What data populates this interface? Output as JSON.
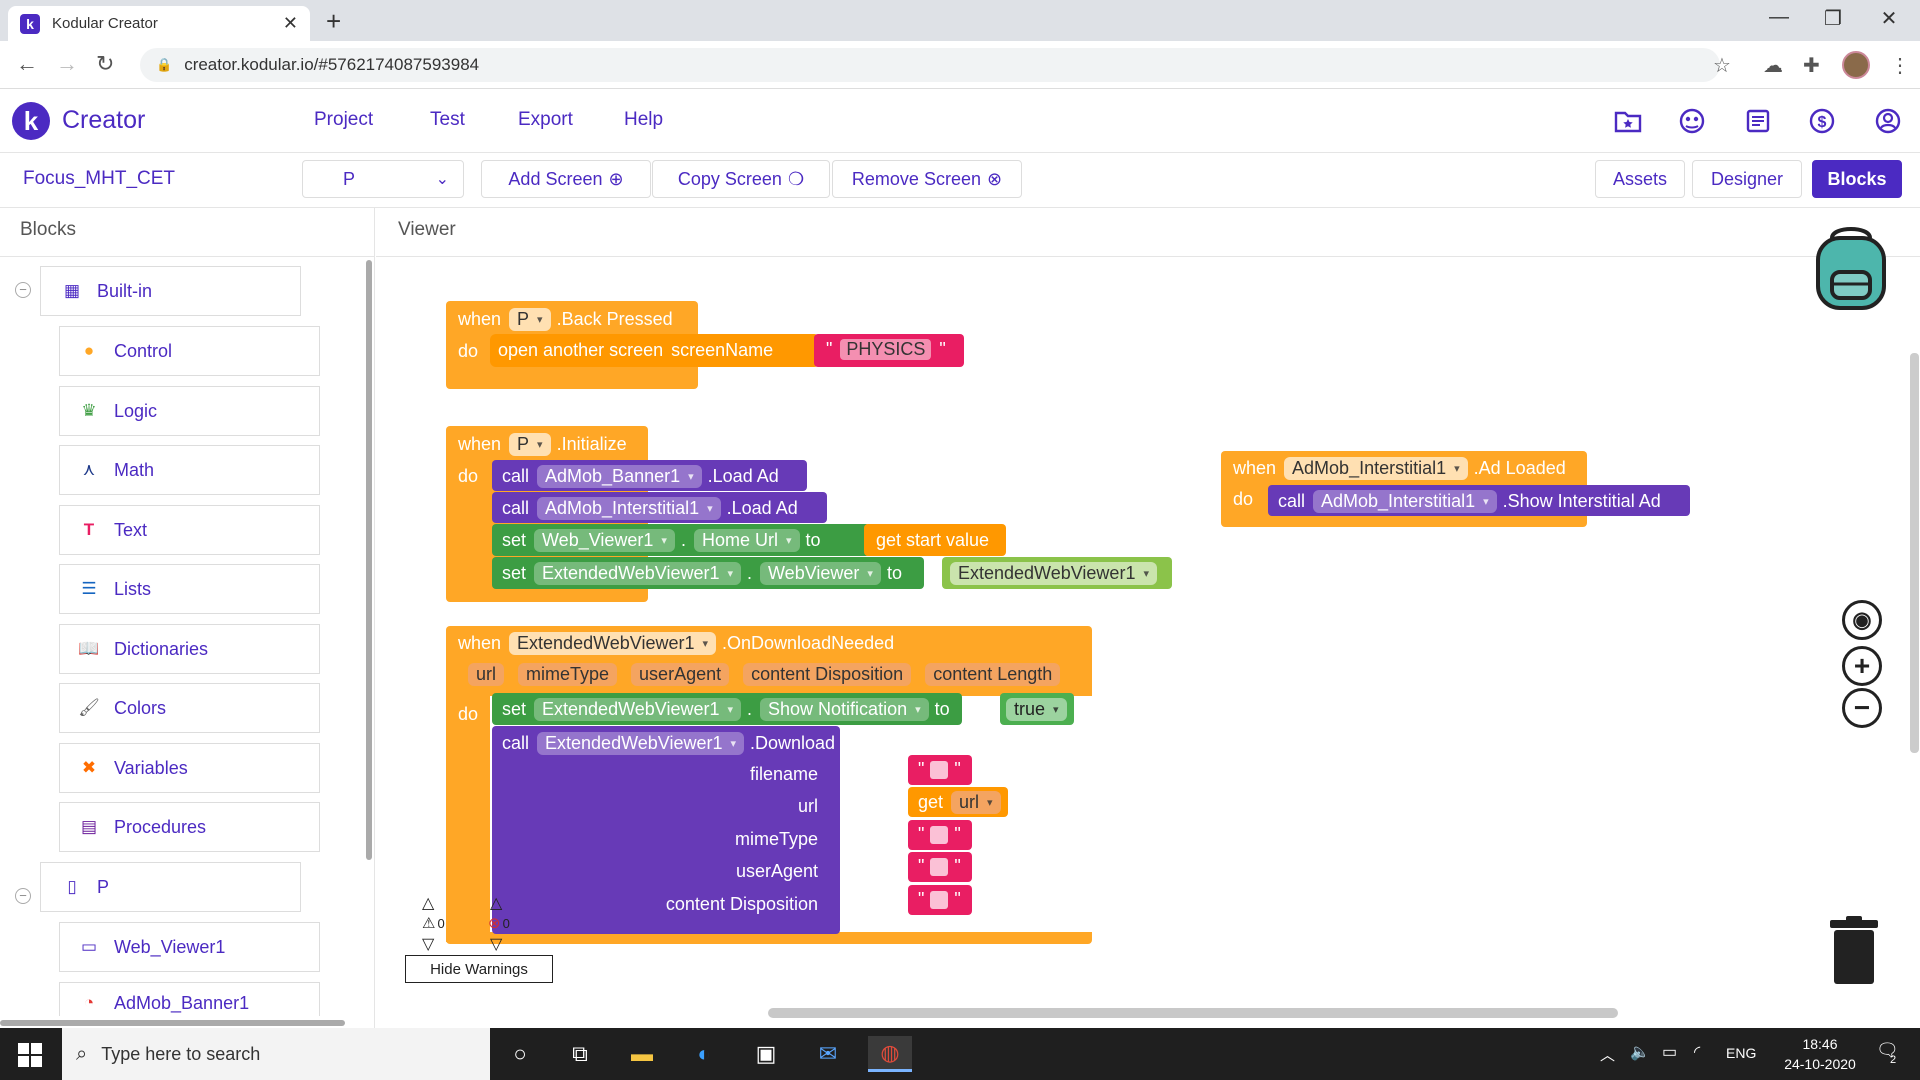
{
  "browser": {
    "tab_title": "Kodular Creator",
    "tab_close": "✕",
    "new_tab": "+",
    "url": "creator.kodular.io/#5762174087593984"
  },
  "app": {
    "brand": "Creator",
    "menu": [
      "Project",
      "Test",
      "Export",
      "Help"
    ]
  },
  "project_bar": {
    "project_name": "Focus_MHT_CET",
    "screen_selector": "P",
    "add_screen": "Add Screen",
    "copy_screen": "Copy Screen",
    "remove_screen": "Remove Screen",
    "assets": "Assets",
    "designer": "Designer",
    "blocks": "Blocks"
  },
  "blocks_panel": {
    "title": "Blocks",
    "builtin": "Built-in",
    "items": [
      {
        "label": "Control",
        "icon": "control-icon",
        "color": "#ffa726"
      },
      {
        "label": "Logic",
        "icon": "logic-icon",
        "color": "#43a047"
      },
      {
        "label": "Math",
        "icon": "math-icon",
        "color": "#1e3a8a"
      },
      {
        "label": "Text",
        "icon": "text-icon",
        "color": "#e91e63"
      },
      {
        "label": "Lists",
        "icon": "lists-icon",
        "color": "#1565c0"
      },
      {
        "label": "Dictionaries",
        "icon": "dictionaries-icon",
        "color": "#283593"
      },
      {
        "label": "Colors",
        "icon": "colors-icon",
        "color": "#666666"
      },
      {
        "label": "Variables",
        "icon": "variables-icon",
        "color": "#ff6d00"
      },
      {
        "label": "Procedures",
        "icon": "procedures-icon",
        "color": "#6a1b9a"
      }
    ],
    "screen": "P",
    "components": [
      {
        "label": "Web_Viewer1",
        "icon": "web-viewer-icon"
      },
      {
        "label": "AdMob_Banner1",
        "icon": "admob-icon"
      }
    ]
  },
  "viewer": {
    "title": "Viewer",
    "block1": {
      "when": "when",
      "component": "P",
      "event": ".Back Pressed",
      "do": "do",
      "action": "open another screen",
      "param": "screenName",
      "value": "PHYSICS"
    },
    "block2": {
      "when": "when",
      "component": "P",
      "event": ".Initialize",
      "do": "do",
      "call": "call",
      "set": "set",
      "to": "to",
      "line1_comp": "AdMob_Banner1",
      "line1_method": ".Load Ad",
      "line2_comp": "AdMob_Interstitial1",
      "line2_method": ".Load Ad",
      "line3_comp": "Web_Viewer1",
      "line3_prop": "Home Url",
      "line3_value": "get start value",
      "line4_comp": "ExtendedWebViewer1",
      "line4_prop": "WebViewer",
      "line4_value": "ExtendedWebViewer1",
      "dot": "."
    },
    "block3": {
      "when": "when",
      "component": "AdMob_Interstitial1",
      "event": ".Ad Loaded",
      "do": "do",
      "call": "call",
      "call_comp": "AdMob_Interstitial1",
      "call_method": ".Show Interstitial Ad"
    },
    "block4": {
      "when": "when",
      "component": "ExtendedWebViewer1",
      "event": ".OnDownloadNeeded",
      "do": "do",
      "params": [
        "url",
        "mimeType",
        "userAgent",
        "content Disposition",
        "content Length"
      ],
      "set": "set",
      "set_comp": "ExtendedWebViewer1",
      "set_prop": "Show Notification",
      "to": "to",
      "set_value": "true",
      "call": "call",
      "call_comp": "ExtendedWebViewer1",
      "call_method": ".Download File",
      "args": [
        "filename",
        "url",
        "mimeType",
        "userAgent",
        "content Disposition"
      ],
      "get": "get",
      "get_var": "url",
      "dot": "."
    },
    "warnings_count": "0",
    "errors_count": "0",
    "hide_warnings": "Hide Warnings"
  },
  "taskbar": {
    "search_placeholder": "Type here to search",
    "language": "ENG",
    "time": "18:46",
    "date": "24-10-2020",
    "notifications": "2"
  },
  "colors": {
    "brand": "#4b2ac2",
    "event_block": "#ffa726",
    "component_block": "#673ab7",
    "setter_block": "#3c9d43",
    "text_block": "#e91e63"
  }
}
